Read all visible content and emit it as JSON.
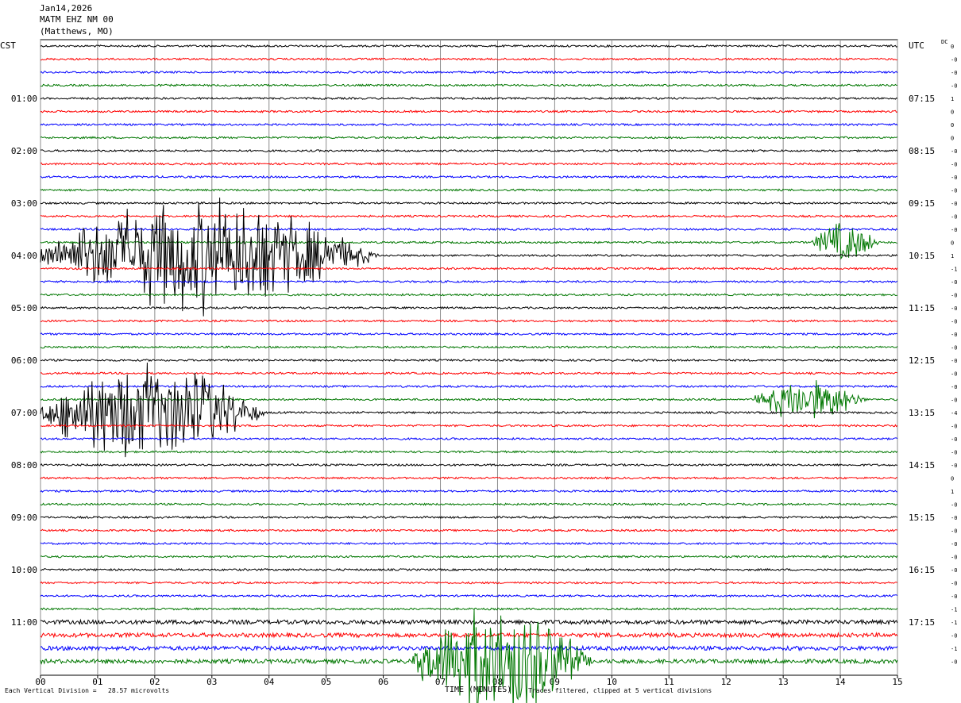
{
  "header": {
    "date": "Jan14,2026",
    "channel": "MATM EHZ NM 00",
    "location": "(Matthews, MO)"
  },
  "axis": {
    "left_timezone": "CST",
    "right_timezone": "UTC",
    "dc_label": "DC"
  },
  "footer": {
    "left": "Each Vertical Division =   28.57 microvolts",
    "center": "TIME (MINUTES)",
    "right": "Traces filtered, clipped at 5 vertical divisions"
  },
  "colors": {
    "trace_cycle": [
      "#000000",
      "#ff0000",
      "#0000ff",
      "#007700"
    ],
    "grid": "#8c8c8c"
  },
  "chart_data": {
    "type": "line",
    "title": "",
    "xlabel": "TIME (MINUTES)",
    "ylabel": "",
    "x_range": [
      0,
      15
    ],
    "x_ticks": [
      "00",
      "01",
      "02",
      "03",
      "04",
      "05",
      "06",
      "07",
      "08",
      "09",
      "10",
      "11",
      "12",
      "13",
      "14",
      "15"
    ],
    "trace_count": 48,
    "minutes_per_trace": 15,
    "left_hour_labels": [
      "01:00",
      "02:00",
      "03:00",
      "04:00",
      "05:00",
      "06:00",
      "07:00",
      "08:00",
      "09:00",
      "10:00",
      "11:00"
    ],
    "right_hour_labels": [
      "07:15",
      "08:15",
      "09:15",
      "10:15",
      "11:15",
      "12:15",
      "13:15",
      "14:15",
      "15:15",
      "16:15",
      "17:15"
    ],
    "dc_offsets": [
      "0",
      "-0",
      "-0",
      "-0",
      "1",
      "0",
      "0",
      "0",
      "-0",
      "-0",
      "-0",
      "-0",
      "-0",
      "-0",
      "-0",
      "0",
      "1",
      "-1",
      "-0",
      "-0",
      "-0",
      "-0",
      "-0",
      "-0",
      "-0",
      "-0",
      "-0",
      "-0",
      "-4",
      "-0",
      "-0",
      "-0",
      "-0",
      "0",
      "1",
      "-0",
      "-0",
      "-0",
      "-0",
      "-0",
      "-0",
      "-0",
      "-0",
      "-1",
      "-1",
      "-0",
      "-1",
      "-0"
    ],
    "events": [
      {
        "trace": 16,
        "start_min": 0.0,
        "end_min": 7.5,
        "strength": 1.0
      },
      {
        "trace": 15,
        "start_min": 13.5,
        "end_min": 15.0,
        "strength": 0.35
      },
      {
        "trace": 28,
        "start_min": 0.0,
        "end_min": 5.0,
        "strength": 0.9
      },
      {
        "trace": 27,
        "start_min": 12.5,
        "end_min": 15.0,
        "strength": 0.35
      },
      {
        "trace": 47,
        "start_min": 6.5,
        "end_min": 10.5,
        "strength": 1.0
      }
    ]
  }
}
